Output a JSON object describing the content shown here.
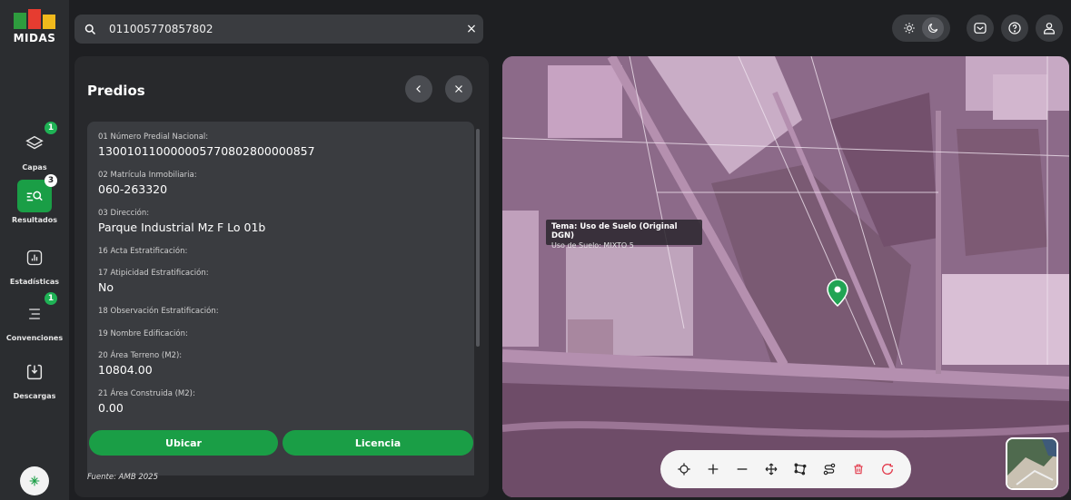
{
  "app": {
    "logo_text": "MIDAS"
  },
  "search": {
    "value": "011005770857802",
    "clear_label": "×"
  },
  "rail": {
    "items": [
      {
        "label": "Capas",
        "badge": "1"
      },
      {
        "label": "Resultados",
        "badge": "3"
      },
      {
        "label": "Estadísticas",
        "badge": ""
      },
      {
        "label": "Convenciones",
        "badge": "1"
      },
      {
        "label": "Descargas",
        "badge": ""
      }
    ]
  },
  "panel": {
    "title": "Predios",
    "fields": [
      {
        "label": "01 Número Predial Nacional:",
        "value": "130010110000005770802800000857"
      },
      {
        "label": "02 Matrícula Inmobiliaria:",
        "value": "060-263320"
      },
      {
        "label": "03 Dirección:",
        "value": "Parque Industrial Mz F Lo 01b"
      },
      {
        "label": "16 Acta Estratificación:",
        "value": ""
      },
      {
        "label": "17 Atipicidad Estratificación:",
        "value": "No"
      },
      {
        "label": "18 Observación Estratificación:",
        "value": ""
      },
      {
        "label": "19 Nombre Edificación:",
        "value": ""
      },
      {
        "label": "20 Área Terreno (M2):",
        "value": "10804.00"
      },
      {
        "label": "21 Área Construida (M2):",
        "value": "0.00"
      }
    ],
    "btn_locate": "Ubicar",
    "btn_license": "Licencia",
    "source": "Fuente: AMB 2025"
  },
  "map": {
    "tooltip_title": "Tema: Uso de Suelo (Original DGN)",
    "tooltip_line": "Uso de Suelo: MIXTO 5",
    "tools": [
      "target-icon",
      "zoom-in-icon",
      "zoom-out-icon",
      "pan-icon",
      "polygon-icon",
      "route-icon",
      "trash-icon",
      "refresh-icon"
    ]
  },
  "colors": {
    "accent": "#1a9e46",
    "panel": "#28292c",
    "overlay": "#a0609a"
  }
}
